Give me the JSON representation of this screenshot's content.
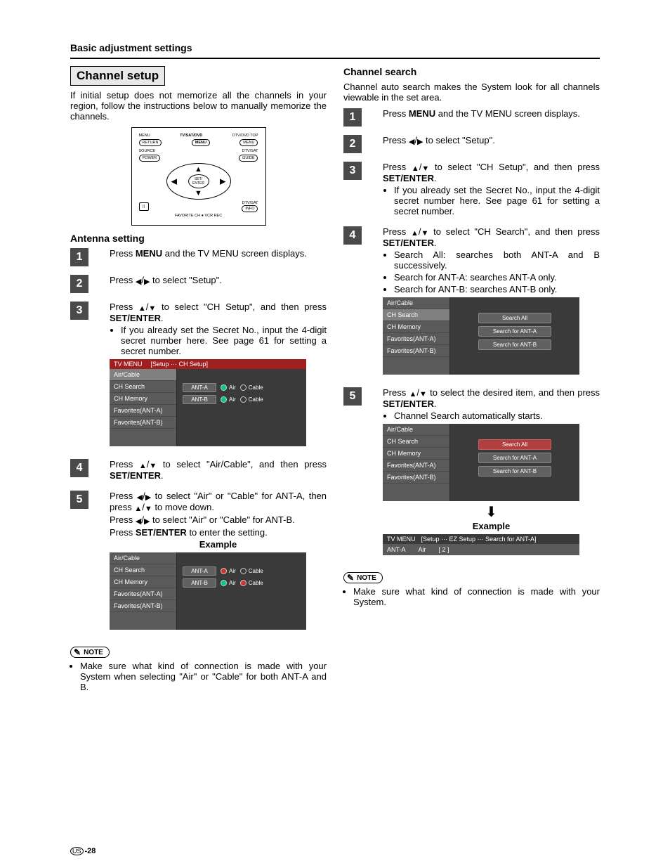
{
  "header": "Basic adjustment settings",
  "left": {
    "title": "Channel setup",
    "intro": "If initial setup does not memorize all the channels in your region, follow the instructions below to manually memorize the channels.",
    "remote": {
      "top1": "MENU",
      "top2": "TV/SAT/DVD",
      "top3": "DTV/DVD TOP",
      "r1a": "RETURN",
      "r1b": "MENU",
      "r1c": "MENU",
      "r2a": "SOURCE",
      "r2c": "DTV/SAT",
      "r3a": "POWER",
      "r3c": "GUIDE",
      "center": "SET/\nENTER",
      "r4c": "DTV/SAT",
      "r5c": "INFO",
      "bl": "||",
      "bottom": "FAVORITE CH   ● VCR REC"
    },
    "sub": "Antenna setting",
    "steps": {
      "s1": {
        "n": "1",
        "p1a": "Press ",
        "p1b": "MENU",
        "p1c": " and the TV MENU screen displays."
      },
      "s2": {
        "n": "2",
        "p1a": "Press ",
        "arr1": "◀",
        "arr2": "▶",
        "p1c": " to select \"Setup\"."
      },
      "s3": {
        "n": "3",
        "p1a": "Press ",
        "arr1": "▲",
        "arr2": "▼",
        "p1c": " to select \"CH Setup\", and then press ",
        "p1d": "SET/ENTER",
        "p1e": ".",
        "b1": "If you already set the Secret No., input the 4-digit secret number here. See page 61 for setting a secret number."
      },
      "s4": {
        "n": "4",
        "p1a": "Press ",
        "arr1": "▲",
        "arr2": "▼",
        "p1c": " to select \"Air/Cable\", and then press ",
        "p1d": "SET/ENTER",
        "p1e": "."
      },
      "s5": {
        "n": "5",
        "l1a": "Press ",
        "a1": "◀",
        "a2": "▶",
        "l1b": " to select \"Air\" or \"Cable\" for ANT-A, then press ",
        "a3": "▲",
        "a4": "▼",
        "l1c": " to move down.",
        "l2a": "Press ",
        "l2b": " to select \"Air\" or \"Cable\" for ANT-B.",
        "l3a": "Press ",
        "l3b": "SET/ENTER",
        "l3c": " to enter the setting."
      }
    },
    "osd1": {
      "hdr1": "TV MENU",
      "hdr2": "[Setup ··· CH Setup]",
      "side": [
        "Air/Cable",
        "CH Search",
        "CH Memory",
        "Favorites(ANT-A)",
        "Favorites(ANT-B)"
      ],
      "row1": {
        "label": "ANT-A",
        "o1": "Air",
        "o2": "Cable"
      },
      "row2": {
        "label": "ANT-B",
        "o1": "Air",
        "o2": "Cable"
      }
    },
    "example": "Example",
    "note_label": "NOTE",
    "note": "Make sure what kind of connection is made with your System when selecting \"Air\" or \"Cable\" for both ANT-A and B."
  },
  "right": {
    "title": "Channel search",
    "intro": "Channel auto search makes the System look for all channels viewable in the set area.",
    "steps": {
      "s1": {
        "n": "1",
        "p1a": "Press ",
        "p1b": "MENU",
        "p1c": " and the TV MENU screen displays."
      },
      "s2": {
        "n": "2",
        "p1a": "Press ",
        "arr1": "◀",
        "arr2": "▶",
        "p1c": " to select \"Setup\"."
      },
      "s3": {
        "n": "3",
        "p1a": "Press ",
        "arr1": "▲",
        "arr2": "▼",
        "p1c": " to select \"CH Setup\", and then press ",
        "p1d": "SET/ENTER",
        "p1e": ".",
        "b1": "If you already set the Secret No., input the 4-digit secret number here. See page 61 for setting a secret number."
      },
      "s4": {
        "n": "4",
        "p1a": "Press ",
        "arr1": "▲",
        "arr2": "▼",
        "p1c": " to select \"CH Search\", and then press ",
        "p1d": "SET/ENTER",
        "p1e": ".",
        "b1": "Search All: searches both ANT-A and B successively.",
        "b2": "Search for ANT-A: searches ANT-A only.",
        "b3": "Search for ANT-B: searches ANT-B only."
      },
      "s5": {
        "n": "5",
        "p1a": "Press ",
        "arr1": "▲",
        "arr2": "▼",
        "p1c": " to select the desired item, and then press ",
        "p1d": "SET/ENTER",
        "p1e": ".",
        "b1": "Channel Search automatically starts."
      }
    },
    "osd_side": [
      "Air/Cable",
      "CH Search",
      "CH Memory",
      "Favorites(ANT-A)",
      "Favorites(ANT-B)"
    ],
    "osd_btns": [
      "Search All",
      "Search for ANT-A",
      "Search for ANT-B"
    ],
    "example": "Example",
    "osd3": {
      "hdr1": "TV MENU",
      "hdr2": "[Setup ··· EZ Setup ··· Search for ANT-A]",
      "r1": "ANT-A",
      "r2": "Air",
      "r3": "[   2 ]"
    },
    "note_label": "NOTE",
    "note": "Make sure what kind of connection is made with your System."
  },
  "page": {
    "region": "US",
    "num": "-28"
  }
}
